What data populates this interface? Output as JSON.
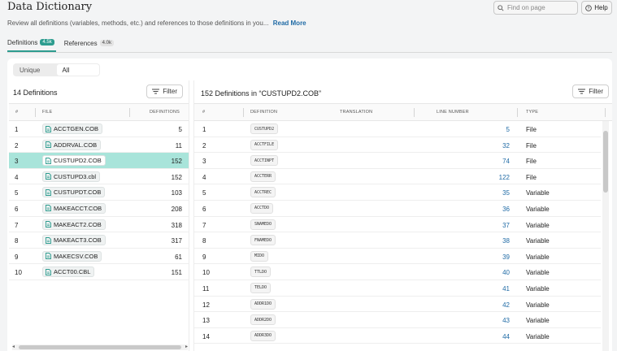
{
  "header": {
    "title": "Data Dictionary",
    "subtitle": "Review all definitions (variables, methods, etc.) and references to those definitions in you...",
    "read_more": "Read More",
    "search_placeholder": "Find on page",
    "help_label": "Help"
  },
  "tabs": [
    {
      "label": "Definitions",
      "badge": "4.5k",
      "active": true
    },
    {
      "label": "References",
      "badge": "4.0k",
      "active": false
    }
  ],
  "segment": {
    "options": [
      "Unique",
      "All"
    ],
    "selected": "All"
  },
  "left": {
    "title": "14 Definitions",
    "filter_label": "Filter",
    "columns": [
      "#",
      "FILE",
      "DEFINITIONS"
    ],
    "rows": [
      {
        "num": "1",
        "file": "ACCTGEN.COB",
        "defs": "5"
      },
      {
        "num": "2",
        "file": "ADDRVAL.COB",
        "defs": "11"
      },
      {
        "num": "3",
        "file": "CUSTUPD2.COB",
        "defs": "152"
      },
      {
        "num": "4",
        "file": "CUSTUPD3.cbl",
        "defs": "152"
      },
      {
        "num": "5",
        "file": "CUSTUPDT.COB",
        "defs": "103"
      },
      {
        "num": "6",
        "file": "MAKEACCT.COB",
        "defs": "208"
      },
      {
        "num": "7",
        "file": "MAKEACT2.COB",
        "defs": "318"
      },
      {
        "num": "8",
        "file": "MAKEACT3.COB",
        "defs": "317"
      },
      {
        "num": "9",
        "file": "MAKECSV.COB",
        "defs": "61"
      },
      {
        "num": "10",
        "file": "ACCT00.CBL",
        "defs": "151"
      }
    ],
    "selected_index": 2
  },
  "right": {
    "title": "152 Definitions in “CUSTUPD2.COB”",
    "filter_label": "Filter",
    "columns": [
      "#",
      "DEFINITION",
      "TRANSLATION",
      "LINE NUMBER",
      "TYPE"
    ],
    "rows": [
      {
        "num": "1",
        "def": "CUSTUPD2",
        "line": "5",
        "type": "File"
      },
      {
        "num": "2",
        "def": "ACCTFILE",
        "line": "32",
        "type": "File"
      },
      {
        "num": "3",
        "def": "ACCTINPT",
        "line": "74",
        "type": "File"
      },
      {
        "num": "4",
        "def": "ACCTERR",
        "line": "122",
        "type": "File"
      },
      {
        "num": "5",
        "def": "ACCTREC",
        "line": "35",
        "type": "Variable"
      },
      {
        "num": "6",
        "def": "ACCTDO",
        "line": "36",
        "type": "Variable"
      },
      {
        "num": "7",
        "def": "SNAMEDO",
        "line": "37",
        "type": "Variable"
      },
      {
        "num": "8",
        "def": "FNAMEDO",
        "line": "38",
        "type": "Variable"
      },
      {
        "num": "9",
        "def": "MIDO",
        "line": "39",
        "type": "Variable"
      },
      {
        "num": "10",
        "def": "TTLDO",
        "line": "40",
        "type": "Variable"
      },
      {
        "num": "11",
        "def": "TELDO",
        "line": "41",
        "type": "Variable"
      },
      {
        "num": "12",
        "def": "ADDR1DO",
        "line": "42",
        "type": "Variable"
      },
      {
        "num": "13",
        "def": "ADDR2DO",
        "line": "43",
        "type": "Variable"
      },
      {
        "num": "14",
        "def": "ADDR3DO",
        "line": "44",
        "type": "Variable"
      }
    ]
  },
  "colors": {
    "accent": "#2d9c8f",
    "selected_row": "#a8e4da",
    "link": "#1f6aa5"
  }
}
